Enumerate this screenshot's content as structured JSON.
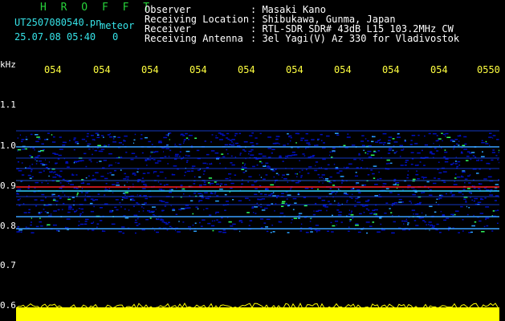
{
  "header": {
    "app_title": "H R O F F T",
    "filename": "UT2507080540.pn",
    "mode": "meteor",
    "datetime": "25.07.08 05:40",
    "count": "0",
    "observer_label": "Observer",
    "observer_value": ": Masaki Kano",
    "location_label": "Receiving Location",
    "location_value": ": Shibukawa, Gunma, Japan",
    "receiver_label": "Receiver",
    "receiver_value": ": RTL-SDR SDR# 43dB L15 103.2MHz CW",
    "antenna_label": "Receiving Antenna",
    "antenna_value": ": 3el Yagi(V) Az 330 for Vladivostok"
  },
  "yaxis": {
    "unit": "kHz",
    "ticks": [
      "1.1",
      "1.0",
      "0.9",
      "0.8",
      "0.7",
      "0.6"
    ]
  },
  "xaxis": {
    "ticks": [
      "054",
      "054",
      "054",
      "054",
      "054",
      "054",
      "054",
      "054",
      "054",
      "0550"
    ]
  },
  "colors": {
    "background": "#000000",
    "spectrum_base": "#00008b",
    "signal_red": "#ff2020",
    "noise_bar": "#ffff00"
  }
}
